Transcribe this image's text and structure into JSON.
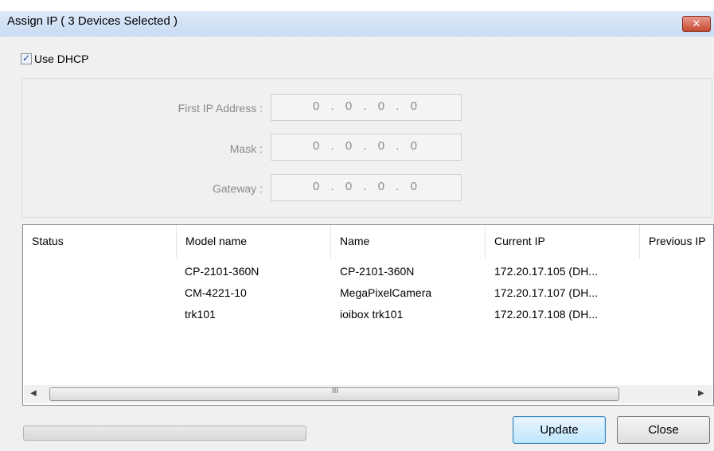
{
  "window": {
    "title": "Assign IP ( 3 Devices Selected )",
    "close_glyph": "✕"
  },
  "dhcp": {
    "label": "Use DHCP",
    "checked": true,
    "check_glyph": "✓"
  },
  "fields": {
    "first_ip": {
      "label": "First IP Address :",
      "value": "0 . 0 . 0 . 0"
    },
    "mask": {
      "label": "Mask :",
      "value": "0 . 0 . 0 . 0"
    },
    "gateway": {
      "label": "Gateway :",
      "value": "0 . 0 . 0 . 0"
    }
  },
  "table": {
    "columns": [
      "Status",
      "Model name",
      "Name",
      "Current IP",
      "Previous IP"
    ],
    "rows": [
      {
        "status": "",
        "model": "CP-2101-360N",
        "name": "CP-2101-360N",
        "current_ip": "172.20.17.105 (DH..."
      },
      {
        "status": "",
        "model": "CM-4221-10",
        "name": "MegaPixelCamera",
        "current_ip": "172.20.17.107 (DH..."
      },
      {
        "status": "",
        "model": "trk101",
        "name": "ioibox trk101",
        "current_ip": "172.20.17.108 (DH..."
      }
    ],
    "scroll_left_glyph": "◀",
    "scroll_right_glyph": "▶",
    "thumb_grip": "III"
  },
  "progress": {
    "value": 0
  },
  "buttons": {
    "update": "Update",
    "close": "Close"
  }
}
